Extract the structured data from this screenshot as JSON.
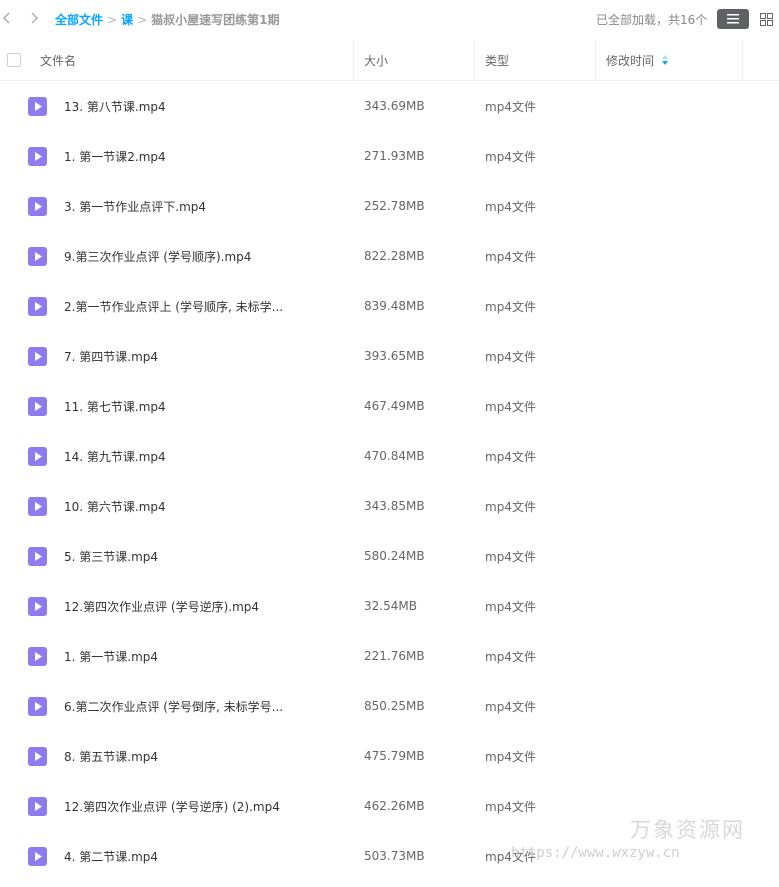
{
  "breadcrumb": {
    "root": "全部文件",
    "parent": "课",
    "current": "猫叔小屋速写团练第1期",
    "separator": ">"
  },
  "status_text": "已全部加载，共16个",
  "columns": {
    "name": "文件名",
    "size": "大小",
    "type": "类型",
    "modified": "修改时间"
  },
  "files": [
    {
      "name": "13. 第八节课.mp4",
      "size": "343.69MB",
      "type": "mp4文件"
    },
    {
      "name": "1. 第一节课2.mp4",
      "size": "271.93MB",
      "type": "mp4文件"
    },
    {
      "name": "3. 第一节作业点评下.mp4",
      "size": "252.78MB",
      "type": "mp4文件"
    },
    {
      "name": "9.第三次作业点评 (学号顺序).mp4",
      "size": "822.28MB",
      "type": "mp4文件"
    },
    {
      "name": "2.第一节作业点评上 (学号顺序, 未标学...",
      "size": "839.48MB",
      "type": "mp4文件"
    },
    {
      "name": "7. 第四节课.mp4",
      "size": "393.65MB",
      "type": "mp4文件"
    },
    {
      "name": "11. 第七节课.mp4",
      "size": "467.49MB",
      "type": "mp4文件"
    },
    {
      "name": "14. 第九节课.mp4",
      "size": "470.84MB",
      "type": "mp4文件"
    },
    {
      "name": "10. 第六节课.mp4",
      "size": "343.85MB",
      "type": "mp4文件"
    },
    {
      "name": "5. 第三节课.mp4",
      "size": "580.24MB",
      "type": "mp4文件"
    },
    {
      "name": "12.第四次作业点评 (学号逆序).mp4",
      "size": "32.54MB",
      "type": "mp4文件"
    },
    {
      "name": "1. 第一节课.mp4",
      "size": "221.76MB",
      "type": "mp4文件"
    },
    {
      "name": "6.第二次作业点评 (学号倒序, 未标学号...",
      "size": "850.25MB",
      "type": "mp4文件"
    },
    {
      "name": "8. 第五节课.mp4",
      "size": "475.79MB",
      "type": "mp4文件"
    },
    {
      "name": "12.第四次作业点评 (学号逆序) (2).mp4",
      "size": "462.26MB",
      "type": "mp4文件"
    },
    {
      "name": "4. 第二节课.mp4",
      "size": "503.73MB",
      "type": "mp4文件"
    }
  ],
  "watermark": {
    "line1": "万象资源网",
    "line2": "https://www.wxzyw.cn"
  },
  "icons": {
    "back": "chevron-left-icon",
    "forward": "chevron-right-icon",
    "list_view": "list-view-icon",
    "grid_view": "grid-view-icon",
    "sort": "sort-icon",
    "file": "video-file-icon"
  },
  "colors": {
    "link": "#06a7ff",
    "video_icon": "#8c7cf0",
    "active_view": "#5f6165"
  }
}
